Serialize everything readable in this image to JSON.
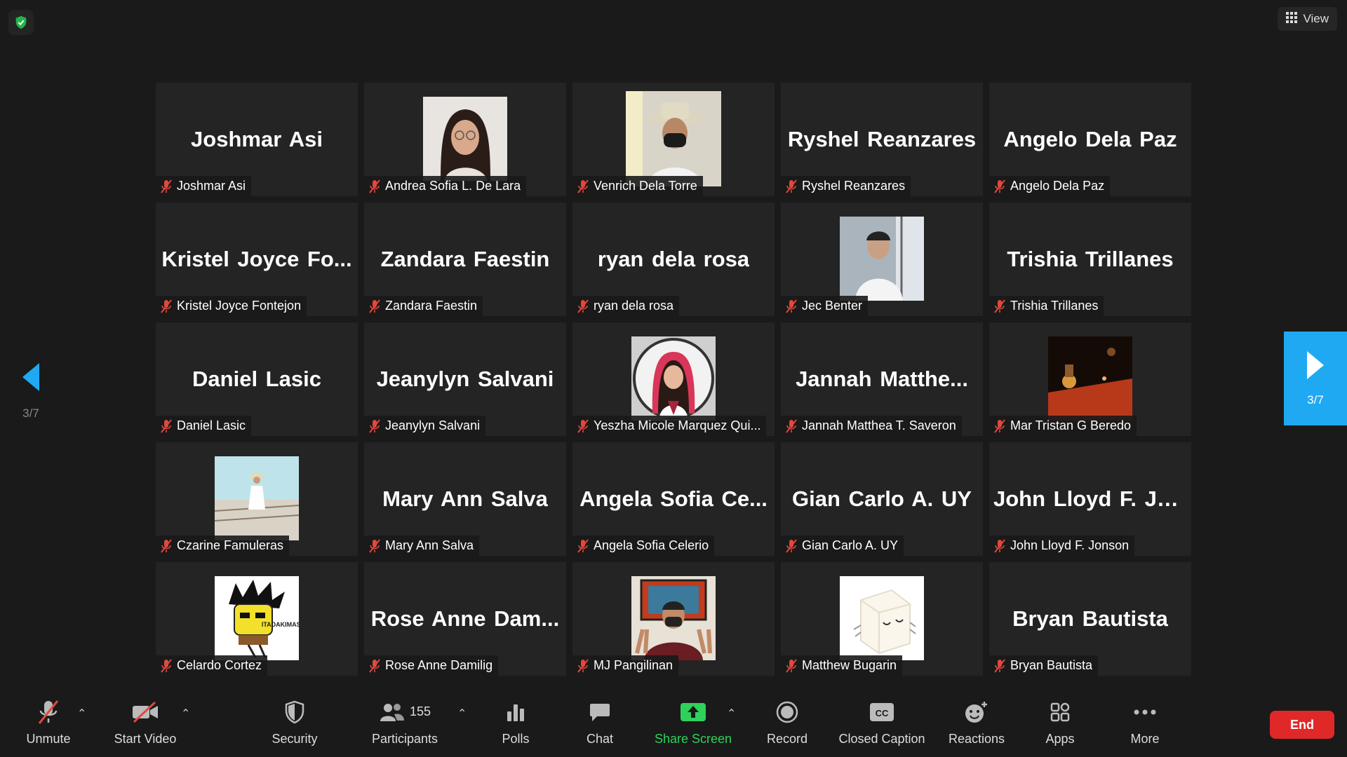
{
  "top": {
    "view_label": "View"
  },
  "navigation": {
    "page_left": "3/7",
    "page_right": "3/7"
  },
  "tiles": [
    {
      "name": "Joshmar Asi",
      "big": "Joshmar Asi",
      "photo": ""
    },
    {
      "name": "Andrea Sofia L. De Lara",
      "big": "",
      "photo": "girl-portrait"
    },
    {
      "name": "Venrich Dela Torre",
      "big": "",
      "photo": "man-hat-mask"
    },
    {
      "name": "Ryshel Reanzares",
      "big": "Ryshel Reanzares",
      "photo": ""
    },
    {
      "name": "Angelo Dela Paz",
      "big": "Angelo Dela Paz",
      "photo": ""
    },
    {
      "name": "Kristel Joyce Fontejon",
      "big": "Kristel Joyce Fo...",
      "photo": ""
    },
    {
      "name": "Zandara Faestin",
      "big": "Zandara Faestin",
      "photo": ""
    },
    {
      "name": "ryan dela rosa",
      "big": "ryan dela rosa",
      "photo": ""
    },
    {
      "name": "Jec Benter",
      "big": "",
      "photo": "boy-uniform"
    },
    {
      "name": "Trishia Trillanes",
      "big": "Trishia Trillanes",
      "photo": ""
    },
    {
      "name": "Daniel Lasic",
      "big": "Daniel Lasic",
      "photo": ""
    },
    {
      "name": "Jeanylyn Salvani",
      "big": "Jeanylyn Salvani",
      "photo": ""
    },
    {
      "name": "Yeszha Micole Marquez Qui...",
      "big": "",
      "photo": "girl-circle"
    },
    {
      "name": "Jannah Matthea T. Saveron",
      "big": "Jannah Matthe...",
      "photo": ""
    },
    {
      "name": "Mar Tristan G Beredo",
      "big": "",
      "photo": "dark-bar"
    },
    {
      "name": "Czarine Famuleras",
      "big": "",
      "photo": "beach"
    },
    {
      "name": "Mary Ann Salva",
      "big": "Mary Ann Salva",
      "photo": ""
    },
    {
      "name": "Angela Sofia Celerio",
      "big": "Angela Sofia Ce...",
      "photo": ""
    },
    {
      "name": "Gian Carlo A. UY",
      "big": "Gian Carlo A. UY",
      "photo": ""
    },
    {
      "name": "John Lloyd F. Jonson",
      "big": "John Lloyd F. Jo...",
      "photo": ""
    },
    {
      "name": "Celardo Cortez",
      "big": "",
      "photo": "cartoon"
    },
    {
      "name": "Rose Anne Damilig",
      "big": "Rose Anne Dam...",
      "photo": ""
    },
    {
      "name": "MJ Pangilinan",
      "big": "",
      "photo": "boy-peace"
    },
    {
      "name": "Matthew Bugarin",
      "big": "",
      "photo": "tofu"
    },
    {
      "name": "Bryan Bautista",
      "big": "Bryan Bautista",
      "photo": ""
    }
  ],
  "toolbar": {
    "unmute": "Unmute",
    "start_video": "Start Video",
    "security": "Security",
    "participants": "Participants",
    "participants_count": "155",
    "polls": "Polls",
    "chat": "Chat",
    "share_screen": "Share Screen",
    "record": "Record",
    "closed_caption": "Closed Caption",
    "reactions": "Reactions",
    "apps": "Apps",
    "more": "More",
    "end": "End"
  },
  "colors": {
    "background": "#1a1a1a",
    "tile": "#242424",
    "accent_blue": "#1fa9f3",
    "share_green": "#2fd15a",
    "end_red": "#e02828",
    "mute_red": "#e0483e"
  }
}
